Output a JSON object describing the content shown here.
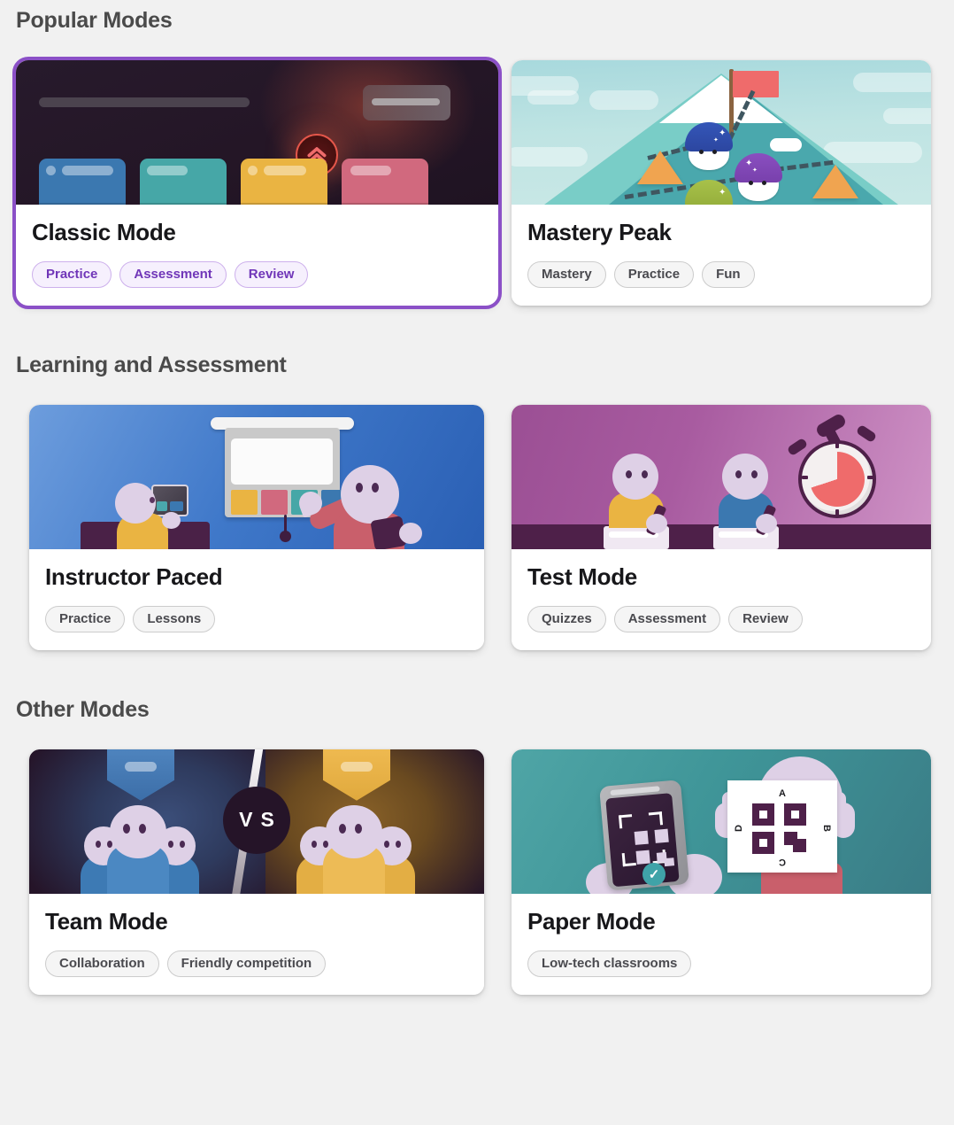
{
  "sections": [
    {
      "id": "popular",
      "title": "Popular Modes",
      "cards": [
        {
          "name": "Classic Mode",
          "selected": true,
          "tags": [
            "Practice",
            "Assessment",
            "Review"
          ]
        },
        {
          "name": "Mastery Peak",
          "selected": false,
          "tags": [
            "Mastery",
            "Practice",
            "Fun"
          ]
        }
      ]
    },
    {
      "id": "learning",
      "title": "Learning and Assessment",
      "cards": [
        {
          "name": "Instructor Paced",
          "selected": false,
          "tags": [
            "Practice",
            "Lessons"
          ]
        },
        {
          "name": "Test Mode",
          "selected": false,
          "tags": [
            "Quizzes",
            "Assessment",
            "Review"
          ]
        }
      ]
    },
    {
      "id": "other",
      "title": "Other Modes",
      "cards": [
        {
          "name": "Team Mode",
          "selected": false,
          "tags": [
            "Collaboration",
            "Friendly competition"
          ]
        },
        {
          "name": "Paper Mode",
          "selected": false,
          "tags": [
            "Low-tech classrooms"
          ]
        }
      ]
    }
  ],
  "illustrations": {
    "team": {
      "vs_label": "VS"
    },
    "paper": {
      "answer_labels": [
        "A",
        "B",
        "C",
        "D"
      ]
    }
  },
  "colors": {
    "page_background": "#f1f1f1",
    "selected_outline": "#8b50c7",
    "selected_tag_text": "#7036b8",
    "selected_tag_background": "#f6f0fd",
    "selected_tag_border": "#cdb0ec",
    "tag_text": "#4a4a4f",
    "tag_background": "#f5f5f5",
    "tag_border": "#cccccc",
    "section_title": "#4a4a4a",
    "card_title": "#17171a",
    "card_background": "#ffffff"
  }
}
